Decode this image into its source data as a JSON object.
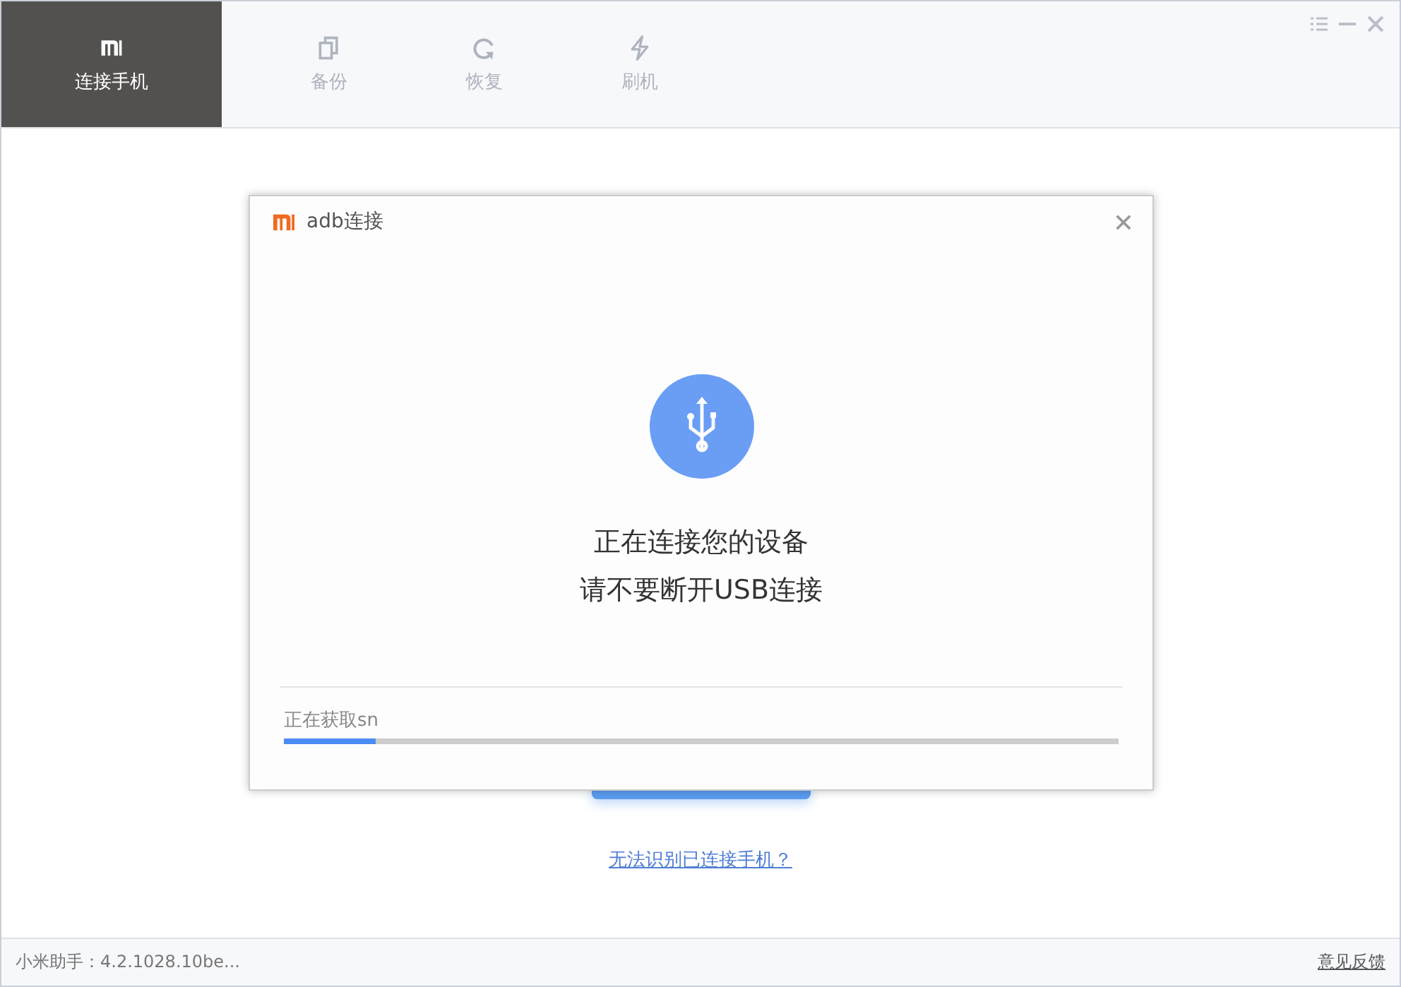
{
  "tabs": [
    {
      "label": "连接手机",
      "kind": "logo",
      "selected": true
    },
    {
      "label": "备份",
      "kind": "copy",
      "selected": false
    },
    {
      "label": "恢复",
      "kind": "refresh",
      "selected": false
    },
    {
      "label": "刷机",
      "kind": "bolt",
      "selected": false
    }
  ],
  "dialog": {
    "title": "adb连接",
    "message": [
      "正在连接您的设备",
      "请不要断开USB连接"
    ],
    "progress": {
      "label": "正在获取sn",
      "level": 0.11
    }
  },
  "help_link": "无法识别已连接手机？",
  "status_bar": {
    "version": "小米助手：4.2.1028.10be...",
    "feedback": "意见反馈"
  }
}
